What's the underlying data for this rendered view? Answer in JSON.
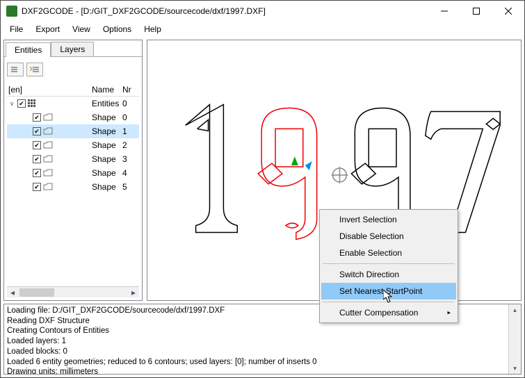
{
  "title": "DXF2GCODE - [D:/GIT_DXF2GCODE/sourcecode/dxf/1997.DXF]",
  "menu": {
    "file": "File",
    "export": "Export",
    "view": "View",
    "options": "Options",
    "help": "Help"
  },
  "tabs": {
    "entities": "Entities",
    "layers": "Layers"
  },
  "tree": {
    "head_group": "[en]",
    "head_name": "Name",
    "head_nr": "Nr",
    "root_name": "Entities",
    "root_nr": "0",
    "rows": [
      {
        "name": "Shape",
        "nr": "0"
      },
      {
        "name": "Shape",
        "nr": "1"
      },
      {
        "name": "Shape",
        "nr": "2"
      },
      {
        "name": "Shape",
        "nr": "3"
      },
      {
        "name": "Shape",
        "nr": "4"
      },
      {
        "name": "Shape",
        "nr": "5"
      }
    ],
    "selected_index": 1
  },
  "context_menu": {
    "invert": "Invert Selection",
    "disable": "Disable Selection",
    "enable": "Enable Selection",
    "switch": "Switch Direction",
    "startpoint": "Set Nearest StartPoint",
    "cutter": "Cutter Compensation"
  },
  "log": "Loading file: D:/GIT_DXF2GCODE/sourcecode/dxf/1997.DXF\nReading DXF Structure\nCreating Contours of Entities\nLoaded layers: 1\nLoaded blocks: 0\nLoaded 6 entity geometries; reduced to 6 contours; used layers: [0]; number of inserts 0\nDrawing units: millimeters"
}
